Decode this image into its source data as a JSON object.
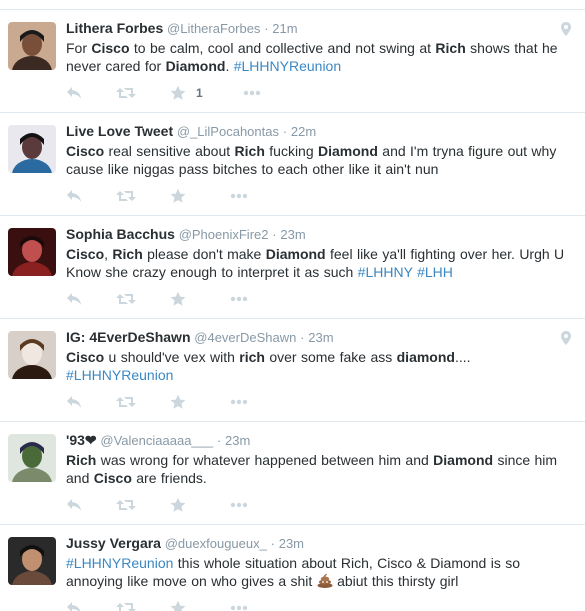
{
  "tweets": [
    {
      "fullname": "Lithera Forbes",
      "username": "@LitheraForbes",
      "time": "21m",
      "geo": true,
      "segments": [
        {
          "t": "For "
        },
        {
          "t": "Cisco",
          "b": true
        },
        {
          "t": " to be  calm, cool and collective and not swing at "
        },
        {
          "t": "Rich",
          "b": true
        },
        {
          "t": " shows that he never cared for "
        },
        {
          "t": "Diamond",
          "b": true
        },
        {
          "t": ". "
        },
        {
          "t": "#LHHNYReunion",
          "tag": true
        }
      ],
      "favorite_count": "1"
    },
    {
      "fullname": "Live Love Tweet",
      "username": "@_LilPocahontas",
      "time": "22m",
      "geo": false,
      "segments": [
        {
          "t": "Cisco",
          "b": true
        },
        {
          "t": " real sensitive about "
        },
        {
          "t": "Rich",
          "b": true
        },
        {
          "t": " fucking "
        },
        {
          "t": "Diamond",
          "b": true
        },
        {
          "t": " and I'm tryna figure out why cause like niggas pass bitches to each other like it ain't nun"
        }
      ],
      "favorite_count": ""
    },
    {
      "fullname": "Sophia Bacchus",
      "username": "@PhoenixFire2",
      "time": "23m",
      "geo": false,
      "segments": [
        {
          "t": "Cisco",
          "b": true
        },
        {
          "t": ", "
        },
        {
          "t": "Rich",
          "b": true
        },
        {
          "t": " please don't make "
        },
        {
          "t": "Diamond",
          "b": true
        },
        {
          "t": " feel like ya'll fighting over her. Urgh U Know she crazy enough to interpret it as such "
        },
        {
          "t": "#LHHNY",
          "tag": true
        },
        {
          "t": " "
        },
        {
          "t": "#LHH",
          "tag": true
        }
      ],
      "favorite_count": ""
    },
    {
      "fullname": "IG: 4EverDeShawn",
      "username": "@4everDeShawn",
      "time": "23m",
      "geo": true,
      "segments": [
        {
          "t": "Cisco",
          "b": true
        },
        {
          "t": " u should've vex with "
        },
        {
          "t": "rich",
          "b": true
        },
        {
          "t": " over some fake ass "
        },
        {
          "t": "diamond",
          "b": true
        },
        {
          "t": ".... "
        },
        {
          "t": "#LHHNYReunion",
          "tag": true
        }
      ],
      "favorite_count": ""
    },
    {
      "fullname": "'93❤",
      "username": "@Valenciaaaaa___",
      "time": "23m",
      "geo": false,
      "segments": [
        {
          "t": "Rich",
          "b": true
        },
        {
          "t": " was wrong for whatever happened between him and "
        },
        {
          "t": "Diamond",
          "b": true
        },
        {
          "t": " since him and "
        },
        {
          "t": "Cisco",
          "b": true
        },
        {
          "t": " are friends."
        }
      ],
      "favorite_count": ""
    },
    {
      "fullname": "Jussy Vergara",
      "username": "@duexfougueux_",
      "time": "23m",
      "geo": false,
      "segments": [
        {
          "t": "#LHHNYReunion",
          "tag": true
        },
        {
          "t": " this whole situation about Rich, Cisco & Diamond is so annoying like move on who gives a shit "
        },
        {
          "t": "",
          "emoji": "pile-of-poo-icon"
        },
        {
          "t": " abiut this thirsty girl"
        }
      ],
      "favorite_count": ""
    }
  ],
  "colors": {
    "text": "#292f33",
    "meta": "#8899a6",
    "hashtag": "#3b88c3",
    "action_icon": "#ccd6dd",
    "border": "#e1e8ed"
  }
}
